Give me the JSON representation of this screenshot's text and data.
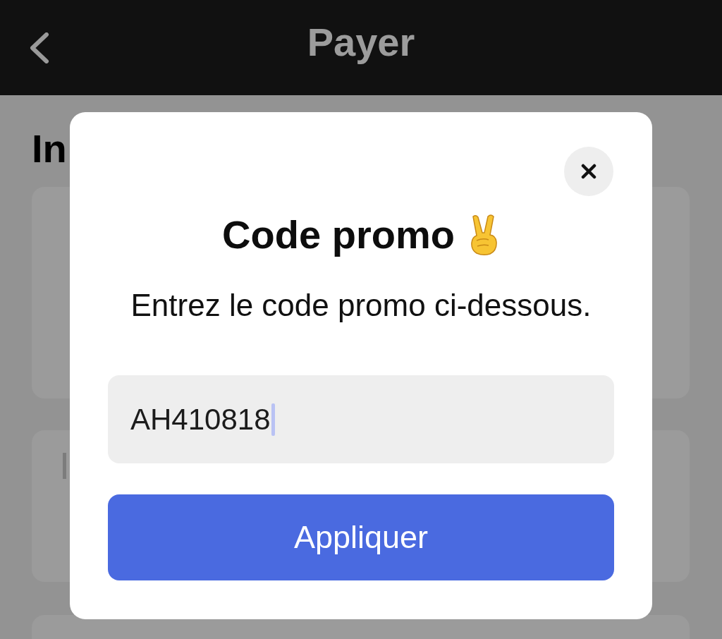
{
  "header": {
    "title": "Payer"
  },
  "page": {
    "heading": "In",
    "cards": [
      {
        "kind": "blank"
      },
      {
        "kind": "text",
        "label": "I"
      },
      {
        "kind": "blank"
      }
    ]
  },
  "dialog": {
    "title": "Code promo",
    "subtitle": "Entrez le code promo ci-dessous.",
    "field": {
      "value": "AH410818",
      "focused": true
    },
    "button": "Appliquer"
  }
}
